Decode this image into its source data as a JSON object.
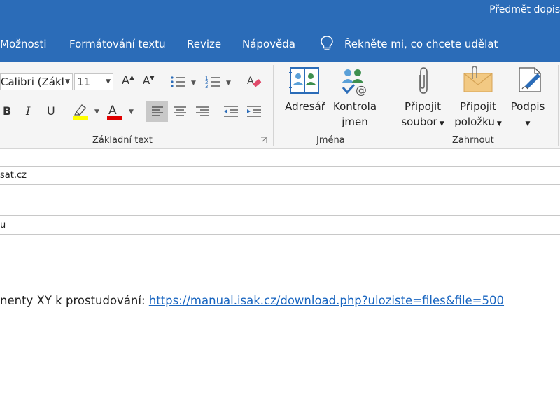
{
  "titlebar": {
    "title": "Předmět dopis"
  },
  "menu": {
    "items": [
      "Možnosti",
      "Formátování textu",
      "Revize",
      "Nápověda"
    ],
    "tell_me": "Řekněte mi, co chcete udělat"
  },
  "ribbon": {
    "font_name": "Calibri (Zákl",
    "font_size": "11",
    "bold": "B",
    "italic": "I",
    "underline": "U",
    "font_color_letter": "A",
    "grow_font": "A",
    "shrink_font": "A",
    "highlight_color": "#ffff00",
    "font_color": "#e00000",
    "groups": {
      "basic_text": "Základní text",
      "names": "Jména",
      "include": "Zahrnout"
    },
    "names_buttons": {
      "address_book": "Adresář",
      "check_names_line1": "Kontrola",
      "check_names_line2": "jmen"
    },
    "include_buttons": {
      "attach_file_line1": "Připojit",
      "attach_file_line2": "soubor",
      "attach_item_line1": "Připojit",
      "attach_item_line2": "položku",
      "signature": "Podpis"
    }
  },
  "fields": {
    "to_value": "sat.cz",
    "subject_value": "u"
  },
  "body": {
    "text": "nenty XY k prostudování: ",
    "link": "https://manual.isak.cz/download.php?uloziste=files&file=500"
  },
  "colors": {
    "accent": "#2b6cb8",
    "link": "#1a66c0"
  }
}
